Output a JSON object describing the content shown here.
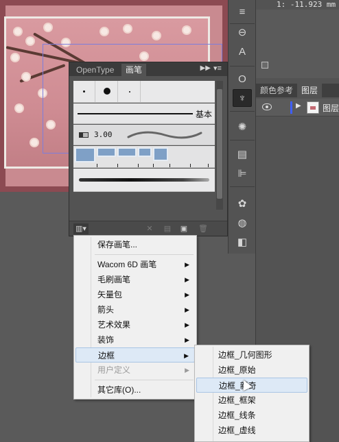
{
  "coordinate_readout": "1: -11.923 mm",
  "right_panel": {
    "tabs": [
      "颜色参考",
      "图层"
    ],
    "active_tab": 1,
    "layer": {
      "name": "图层"
    }
  },
  "brush_panel": {
    "tabs": [
      "OpenType",
      "画笔"
    ],
    "active_tab": 1,
    "basic_label": "基本",
    "calligraphic_size": "3.00"
  },
  "library_menu": {
    "items": [
      {
        "label": "保存画笔...",
        "submenu": false,
        "disabled": false
      },
      {
        "label": "Wacom 6D 画笔",
        "submenu": true,
        "disabled": false
      },
      {
        "label": "毛刷画笔",
        "submenu": true,
        "disabled": false
      },
      {
        "label": "矢量包",
        "submenu": true,
        "disabled": false
      },
      {
        "label": "箭头",
        "submenu": true,
        "disabled": false
      },
      {
        "label": "艺术效果",
        "submenu": true,
        "disabled": false
      },
      {
        "label": "装饰",
        "submenu": true,
        "disabled": false
      },
      {
        "label": "边框",
        "submenu": true,
        "disabled": false,
        "highlighted": true
      },
      {
        "label": "用户定义",
        "submenu": true,
        "disabled": true
      },
      {
        "label": "其它库(O)...",
        "submenu": false,
        "disabled": false
      }
    ]
  },
  "border_submenu": {
    "items": [
      {
        "label": "边框_几何图形"
      },
      {
        "label": "边框_原始"
      },
      {
        "label": "边框_新奇",
        "highlighted": true
      },
      {
        "label": "边框_框架"
      },
      {
        "label": "边框_线条"
      },
      {
        "label": "边框_虚线"
      }
    ]
  },
  "colors": {
    "menu_highlight": "#dde9f6",
    "layer_color": "#3f5fff",
    "ui_panel": "#535353",
    "artwork_frame": "#8c4a52"
  }
}
